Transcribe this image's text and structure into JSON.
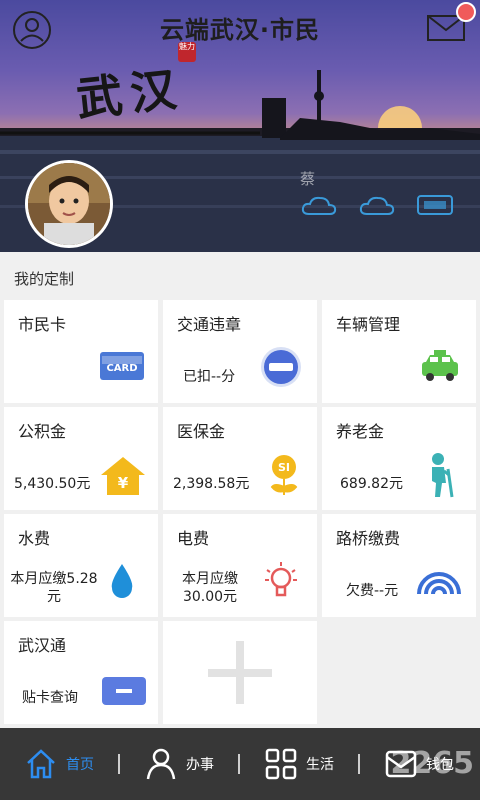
{
  "header": {
    "title": "云端武汉·市民"
  },
  "banner": {
    "calligraphy": "武汉",
    "seal_text": "魅力",
    "user_name": "蔡"
  },
  "section_label": "我的定制",
  "tiles": [
    {
      "title": "市民卡",
      "sub": "",
      "icon": "card-icon",
      "badge": "CARD"
    },
    {
      "title": "交通违章",
      "sub": "已扣--分",
      "icon": "no-entry-icon"
    },
    {
      "title": "车辆管理",
      "sub": "",
      "icon": "taxi-icon"
    },
    {
      "title": "公积金",
      "sub": "5,430.50元",
      "icon": "house-yuan-icon",
      "badge": "¥"
    },
    {
      "title": "医保金",
      "sub": "2,398.58元",
      "icon": "flower-si-icon",
      "badge": "SI"
    },
    {
      "title": "养老金",
      "sub": "689.82元",
      "icon": "elder-icon"
    },
    {
      "title": "水费",
      "sub": "本月应缴5.28元",
      "icon": "water-drop-icon"
    },
    {
      "title": "电费",
      "sub": "本月应缴30.00元",
      "icon": "light-bulb-icon"
    },
    {
      "title": "路桥缴费",
      "sub": "欠费--元",
      "icon": "bridge-arc-icon"
    },
    {
      "title": "武汉通",
      "sub": "贴卡查询",
      "icon": "transit-card-icon"
    }
  ],
  "tabs": [
    {
      "label": "首页",
      "icon": "home-icon",
      "active": true
    },
    {
      "label": "办事",
      "icon": "person-icon",
      "active": false
    },
    {
      "label": "生活",
      "icon": "grid-icon",
      "active": false
    },
    {
      "label": "钱包",
      "icon": "wallet-icon",
      "active": false
    }
  ],
  "watermark": "2265",
  "colors": {
    "active_tab": "#2d8df0",
    "tab_bar": "#373737",
    "notification": "#f05a5a",
    "accent_blue": "#5b7be0"
  }
}
